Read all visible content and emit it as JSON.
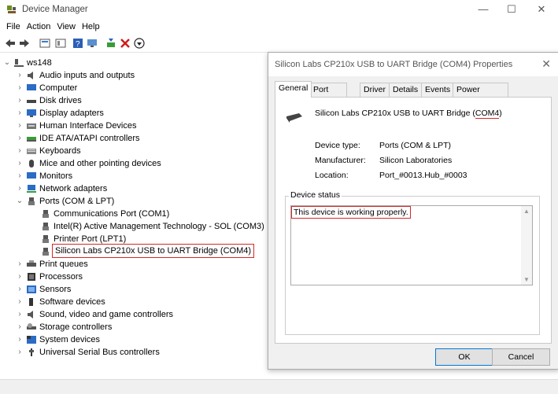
{
  "window": {
    "title": "Device Manager"
  },
  "menu": [
    "File",
    "Action",
    "View",
    "Help"
  ],
  "tree": {
    "root": "ws148",
    "items": [
      {
        "label": "Audio inputs and outputs"
      },
      {
        "label": "Computer"
      },
      {
        "label": "Disk drives"
      },
      {
        "label": "Display adapters"
      },
      {
        "label": "Human Interface Devices"
      },
      {
        "label": "IDE ATA/ATAPI controllers"
      },
      {
        "label": "Keyboards"
      },
      {
        "label": "Mice and other pointing devices"
      },
      {
        "label": "Monitors"
      },
      {
        "label": "Network adapters"
      },
      {
        "label": "Ports (COM & LPT)"
      }
    ],
    "ports": [
      "Communications Port (COM1)",
      "Intel(R) Active Management Technology - SOL (COM3)",
      "Printer Port (LPT1)",
      "Silicon Labs CP210x USB to UART Bridge (COM4)"
    ],
    "after": [
      "Print queues",
      "Processors",
      "Sensors",
      "Software devices",
      "Sound, video and game controllers",
      "Storage controllers",
      "System devices",
      "Universal Serial Bus controllers"
    ]
  },
  "dialog": {
    "title": "Silicon Labs CP210x USB to UART Bridge (COM4) Properties",
    "tabs": [
      "General",
      "Port Settings",
      "Driver",
      "Details",
      "Events",
      "Power Management"
    ],
    "device_name_prefix": "Silicon Labs CP210x USB to UART Bridge (",
    "device_name_port": "COM4",
    "device_name_suffix": ")",
    "fields": [
      {
        "label": "Device type:",
        "value": "Ports (COM & LPT)"
      },
      {
        "label": "Manufacturer:",
        "value": "Silicon Laboratories"
      },
      {
        "label": "Location:",
        "value": "Port_#0013.Hub_#0003"
      }
    ],
    "status_legend": "Device status",
    "status_text": "This device is working properly.",
    "ok": "OK",
    "cancel": "Cancel"
  }
}
